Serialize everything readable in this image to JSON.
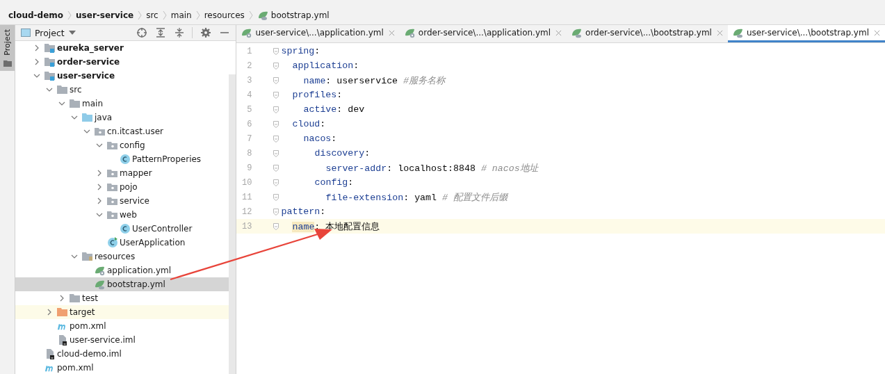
{
  "breadcrumb": [
    {
      "label": "cloud-demo",
      "kind": "module"
    },
    {
      "label": "user-service",
      "kind": "module"
    },
    {
      "label": "src",
      "kind": "folder"
    },
    {
      "label": "main",
      "kind": "folder"
    },
    {
      "label": "resources",
      "kind": "folder"
    },
    {
      "label": "bootstrap.yml",
      "kind": "bootstrap"
    }
  ],
  "side_stripe": {
    "label": "Project",
    "selected": true
  },
  "project_panel": {
    "title": "Project",
    "tree": [
      {
        "label": "eureka_server",
        "kind": "module",
        "expanded": false,
        "selected": false
      },
      {
        "label": "order-service",
        "kind": "module",
        "expanded": false,
        "selected": false
      },
      {
        "label": "user-service",
        "kind": "module",
        "expanded": true,
        "selected": false,
        "children": [
          {
            "label": "src",
            "kind": "folder",
            "expanded": true,
            "selected": false,
            "children": [
              {
                "label": "main",
                "kind": "folder",
                "expanded": true,
                "selected": false,
                "children": [
                  {
                    "label": "java",
                    "kind": "source",
                    "expanded": true,
                    "selected": false,
                    "children": [
                      {
                        "label": "cn.itcast.user",
                        "kind": "package",
                        "expanded": true,
                        "selected": false,
                        "children": [
                          {
                            "label": "config",
                            "kind": "package",
                            "expanded": true,
                            "selected": false,
                            "children": [
                              {
                                "label": "PatternProperies",
                                "kind": "class",
                                "selected": false
                              }
                            ]
                          },
                          {
                            "label": "mapper",
                            "kind": "package",
                            "expanded": false,
                            "selected": false
                          },
                          {
                            "label": "pojo",
                            "kind": "package",
                            "expanded": false,
                            "selected": false
                          },
                          {
                            "label": "service",
                            "kind": "package",
                            "expanded": false,
                            "selected": false
                          },
                          {
                            "label": "web",
                            "kind": "package",
                            "expanded": true,
                            "selected": false,
                            "children": [
                              {
                                "label": "UserController",
                                "kind": "class",
                                "selected": false
                              }
                            ]
                          },
                          {
                            "label": "UserApplication",
                            "kind": "spring-class",
                            "selected": false
                          }
                        ]
                      }
                    ]
                  },
                  {
                    "label": "resources",
                    "kind": "resources",
                    "expanded": true,
                    "selected": false,
                    "children": [
                      {
                        "label": "application.yml",
                        "kind": "application",
                        "selected": false
                      },
                      {
                        "label": "bootstrap.yml",
                        "kind": "bootstrap",
                        "selected": true
                      }
                    ]
                  }
                ]
              },
              {
                "label": "test",
                "kind": "folder",
                "expanded": false,
                "selected": false
              }
            ]
          },
          {
            "label": "target",
            "kind": "excluded",
            "expanded": false,
            "selected": false
          },
          {
            "label": "pom.xml",
            "kind": "maven",
            "selected": false
          },
          {
            "label": "user-service.iml",
            "kind": "iml",
            "selected": false
          }
        ]
      },
      {
        "label": "cloud-demo.iml",
        "kind": "iml",
        "selected": false
      },
      {
        "label": "pom.xml",
        "kind": "maven",
        "selected": false
      }
    ]
  },
  "editor_tabs": [
    {
      "label": "user-service\\...\\application.yml",
      "kind": "application",
      "selected": false
    },
    {
      "label": "order-service\\...\\application.yml",
      "kind": "application",
      "selected": false
    },
    {
      "label": "order-service\\...\\bootstrap.yml",
      "kind": "bootstrap",
      "selected": false
    },
    {
      "label": "user-service\\...\\bootstrap.yml",
      "kind": "bootstrap",
      "selected": true
    }
  ],
  "code_lines": [
    {
      "number": "1",
      "current": false,
      "tokens": [
        {
          "kind": "key",
          "text": "spring"
        },
        {
          "kind": "punct",
          "text": ":"
        }
      ],
      "children": [
        {
          "number": "2",
          "current": false,
          "tokens": [
            {
              "kind": "key",
              "text": "application"
            },
            {
              "kind": "punct",
              "text": ":"
            }
          ],
          "children": [
            {
              "number": "3",
              "current": false,
              "tokens": [
                {
                  "kind": "key",
                  "text": "name"
                },
                {
                  "kind": "punct",
                  "text": ": "
                },
                {
                  "kind": "value",
                  "text": "userservice "
                },
                {
                  "kind": "comment",
                  "text": "#服务名称"
                }
              ]
            }
          ]
        },
        {
          "number": "4",
          "current": false,
          "tokens": [
            {
              "kind": "key",
              "text": "profiles"
            },
            {
              "kind": "punct",
              "text": ":"
            }
          ],
          "children": [
            {
              "number": "5",
              "current": false,
              "tokens": [
                {
                  "kind": "key",
                  "text": "active"
                },
                {
                  "kind": "punct",
                  "text": ": "
                },
                {
                  "kind": "value",
                  "text": "dev"
                }
              ]
            }
          ]
        },
        {
          "number": "6",
          "current": false,
          "tokens": [
            {
              "kind": "key",
              "text": "cloud"
            },
            {
              "kind": "punct",
              "text": ":"
            }
          ],
          "children": [
            {
              "number": "7",
              "current": false,
              "tokens": [
                {
                  "kind": "key",
                  "text": "nacos"
                },
                {
                  "kind": "punct",
                  "text": ":"
                }
              ],
              "children": [
                {
                  "number": "8",
                  "current": false,
                  "tokens": [
                    {
                      "kind": "key",
                      "text": "discovery"
                    },
                    {
                      "kind": "punct",
                      "text": ":"
                    }
                  ],
                  "children": [
                    {
                      "number": "9",
                      "current": false,
                      "tokens": [
                        {
                          "kind": "key",
                          "text": "server-addr"
                        },
                        {
                          "kind": "punct",
                          "text": ": "
                        },
                        {
                          "kind": "value",
                          "text": "localhost:8848 "
                        },
                        {
                          "kind": "comment",
                          "text": "# nacos地址"
                        }
                      ]
                    }
                  ]
                },
                {
                  "number": "10",
                  "current": false,
                  "tokens": [
                    {
                      "kind": "key",
                      "text": "config"
                    },
                    {
                      "kind": "punct",
                      "text": ":"
                    }
                  ],
                  "children": [
                    {
                      "number": "11",
                      "current": false,
                      "tokens": [
                        {
                          "kind": "key",
                          "text": "file-extension"
                        },
                        {
                          "kind": "punct",
                          "text": ": "
                        },
                        {
                          "kind": "value",
                          "text": "yaml "
                        },
                        {
                          "kind": "comment",
                          "text": "# 配置文件后缀"
                        }
                      ]
                    }
                  ]
                }
              ]
            }
          ]
        }
      ]
    },
    {
      "number": "12",
      "current": false,
      "tokens": [
        {
          "kind": "key",
          "text": "pattern"
        },
        {
          "kind": "punct",
          "text": ":"
        }
      ],
      "children": [
        {
          "number": "13",
          "current": true,
          "tokens": [
            {
              "kind": "key-highlight",
              "text": "name"
            },
            {
              "kind": "punct",
              "text": ": "
            },
            {
              "kind": "value",
              "text": "本地配置信息"
            }
          ]
        }
      ]
    }
  ]
}
